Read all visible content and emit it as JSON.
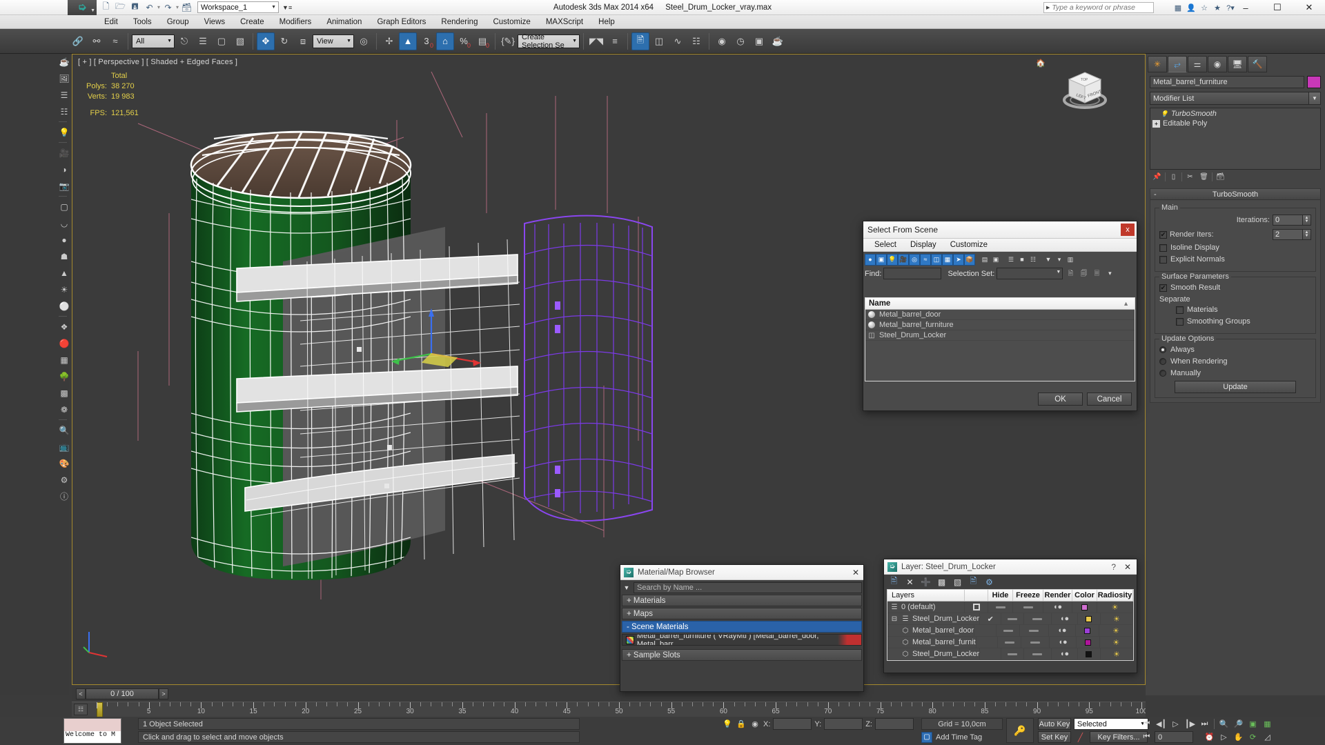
{
  "titlebar": {
    "workspace": "Workspace_1",
    "app_name": "Autodesk 3ds Max  2014 x64",
    "file_name": "Steel_Drum_Locker_vray.max",
    "search_placeholder": "Type a keyword or phrase",
    "minimize": "–",
    "maximize": "☐",
    "close": "✕",
    "qat": [
      "new-icon",
      "open-icon",
      "save-icon",
      "undo-icon",
      "redo-icon",
      "setproject-icon"
    ]
  },
  "menubar": {
    "items": [
      "Edit",
      "Tools",
      "Group",
      "Views",
      "Create",
      "Modifiers",
      "Animation",
      "Graph Editors",
      "Rendering",
      "Customize",
      "MAXScript",
      "Help"
    ]
  },
  "maintoolbar": {
    "selection_filter": "All",
    "reference_coord": "View",
    "named_selection_set": "Create Selection Se",
    "angle_snap": "3",
    "percent_snap": "%",
    "spinner_snap": "0"
  },
  "viewport": {
    "label": "[ + ] [ Perspective ] [ Shaded + Edged Faces ]",
    "stats_header": "Total",
    "stats": [
      {
        "label": "Polys:",
        "value": "38 270"
      },
      {
        "label": "Verts:",
        "value": "19 983"
      }
    ],
    "fps_label": "FPS:",
    "fps_value": "121,561",
    "viewcube_faces": {
      "front": "FRONT",
      "top": "TOP",
      "left": "LEFT"
    }
  },
  "timeslider": {
    "prev": "<",
    "next": ">",
    "current": "0 / 100"
  },
  "trackbar": {
    "ticks": [
      "5",
      "10",
      "15",
      "20",
      "25",
      "30",
      "35",
      "40",
      "45",
      "50",
      "55",
      "60",
      "65",
      "70",
      "75",
      "80",
      "85",
      "90",
      "95",
      "100"
    ]
  },
  "command_panel": {
    "tabs": [
      "create-tab",
      "modify-tab",
      "hierarchy-tab",
      "motion-tab",
      "display-tab",
      "utilities-tab"
    ],
    "object_name": "Metal_barrel_furniture",
    "object_color": "#c838b8",
    "modifier_list_label": "Modifier List",
    "stack": [
      {
        "label": "TurboSmooth",
        "italic": true
      },
      {
        "label": "Editable Poly",
        "italic": false
      }
    ],
    "rollout": {
      "title": "TurboSmooth",
      "collapse_sign": "-",
      "main_group": "Main",
      "iterations_label": "Iterations:",
      "iterations_value": "0",
      "render_iters_label": "Render Iters:",
      "render_iters_value": "2",
      "render_iters_checked": true,
      "isoline_label": "Isoline Display",
      "isoline_checked": false,
      "explicit_normals_label": "Explicit Normals",
      "explicit_normals_checked": false,
      "surface_group": "Surface Parameters",
      "smooth_result_label": "Smooth Result",
      "smooth_result_checked": true,
      "separate_label": "Separate",
      "materials_label": "Materials",
      "materials_checked": false,
      "smoothing_groups_label": "Smoothing Groups",
      "smoothing_groups_checked": false,
      "update_group": "Update Options",
      "update_options": [
        {
          "label": "Always",
          "selected": true
        },
        {
          "label": "When Rendering",
          "selected": false
        },
        {
          "label": "Manually",
          "selected": false
        }
      ],
      "update_button": "Update"
    }
  },
  "select_from_scene": {
    "title": "Select From Scene",
    "close": "x",
    "menu": [
      "Select",
      "Display",
      "Customize"
    ],
    "find_label": "Find:",
    "find_value": "",
    "selection_set_label": "Selection Set:",
    "selection_set_value": "",
    "column_header": "Name",
    "sort_arrow": "▲",
    "rows": [
      {
        "name": "Metal_barrel_door",
        "icon": "geometry-ball-icon"
      },
      {
        "name": "Metal_barrel_furniture",
        "icon": "geometry-ball-icon"
      },
      {
        "name": "Steel_Drum_Locker",
        "icon": "group-icon"
      }
    ],
    "ok": "OK",
    "cancel": "Cancel"
  },
  "material_browser": {
    "title": "Material/Map Browser",
    "close": "✕",
    "search_placeholder": "Search by Name ...",
    "groups": [
      {
        "label": "+ Materials",
        "selected": false
      },
      {
        "label": "+ Maps",
        "selected": false
      },
      {
        "label": "- Scene Materials",
        "selected": true
      }
    ],
    "entry": "Metal_barrel_furniture  ( VRayMtl )  [Metal_barrel_door, Metal_barr...",
    "footer_group": "+ Sample Slots"
  },
  "layer_dialog": {
    "title": "Layer: Steel_Drum_Locker",
    "help": "?",
    "close": "✕",
    "toolbar": [
      "new-layer-icon",
      "delete-layer-icon",
      "add-selection-icon",
      "select-objects-icon",
      "select-highlighted-icon",
      "set-current-icon",
      "layer-properties-icon"
    ],
    "columns": [
      "Layers",
      "",
      "Hide",
      "Freeze",
      "Render",
      "Color",
      "Radiosity"
    ],
    "rows": [
      {
        "name": "0 (default)",
        "icon": "layer-icon",
        "current": "box",
        "indent": 0,
        "color": "#d06fd0",
        "expander": ""
      },
      {
        "name": "Steel_Drum_Locker",
        "icon": "layer-icon",
        "current": "check",
        "indent": 0,
        "color": "#e8c84a",
        "expander": "-"
      },
      {
        "name": "Metal_barrel_door",
        "icon": "object-icon",
        "current": "",
        "indent": 1,
        "color": "#9b3fd6",
        "expander": ""
      },
      {
        "name": "Metal_barrel_furnit",
        "icon": "object-icon",
        "current": "",
        "indent": 1,
        "color": "#b0149b",
        "expander": ""
      },
      {
        "name": "Steel_Drum_Locker",
        "icon": "object-icon",
        "current": "",
        "indent": 1,
        "color": "#121212",
        "expander": ""
      }
    ]
  },
  "statusbar": {
    "listener_text": "Welcome to M",
    "selection_status": "1 Object Selected",
    "prompt": "Click and drag to select and move objects",
    "x_label": "X:",
    "x_value": "",
    "y_label": "Y:",
    "y_value": "",
    "z_label": "Z:",
    "z_value": "",
    "grid_text": "Grid = 10,0cm",
    "add_time_tag": "Add Time Tag",
    "auto_key": "Auto Key",
    "set_key": "Set Key",
    "key_mode": "Selected",
    "key_filters": "Key Filters...",
    "frame_value": "0"
  }
}
